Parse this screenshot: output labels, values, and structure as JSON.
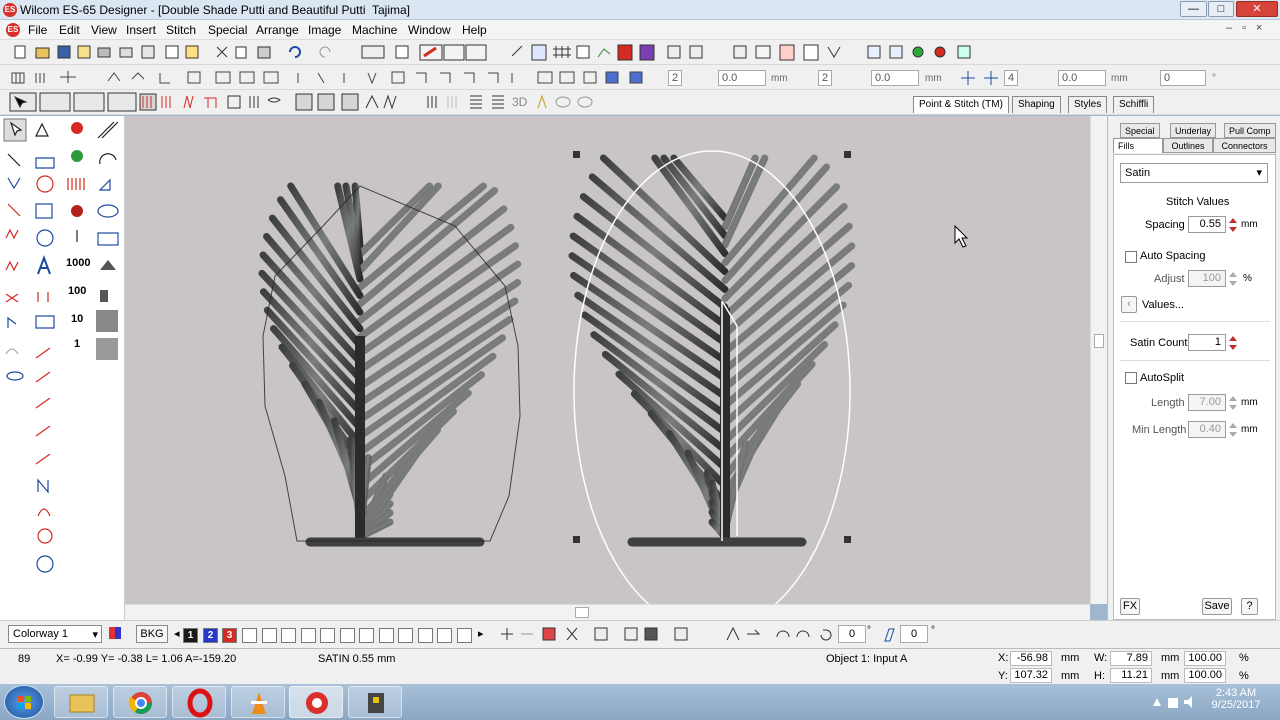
{
  "window": {
    "title": "Wilcom ES-65 Designer - [Double Shade Putti and Beautiful Putti",
    "machine": "Tajima]",
    "app_badge": "ES",
    "controls": [
      "—",
      "□",
      "✕"
    ],
    "inner_controls": [
      "–",
      "▫",
      "×"
    ]
  },
  "menu": [
    "File",
    "Edit",
    "View",
    "Insert",
    "Stitch",
    "Special",
    "Arrange",
    "Image",
    "Machine",
    "Window",
    "Help"
  ],
  "toolbar2": {
    "field1": "2",
    "value1": "0.0",
    "unit1": "mm",
    "field2": "2",
    "value2": "0.0",
    "unit2": "mm",
    "field3": "4",
    "value3": "0.0",
    "unit3": "mm",
    "value4": "0",
    "unit4": "°"
  },
  "toolbar3": {
    "label_3d": "3D"
  },
  "tabs": [
    "Point & Stitch (TM)",
    "Shaping",
    "Styles",
    "Schiffli"
  ],
  "left_tools": {
    "num1": "1000",
    "num2": "100",
    "num3": "10",
    "num4": "1"
  },
  "panel": {
    "tabs_row1": [
      "Special",
      "Underlay",
      "Pull Comp"
    ],
    "tabs_row2": [
      "Fills",
      "Outlines",
      "Connectors"
    ],
    "stitch_type": "Satin",
    "section_title": "Stitch Values",
    "spacing_label": "Spacing",
    "spacing_value": "0.55",
    "spacing_unit": "mm",
    "auto_spacing_label": "Auto Spacing",
    "adjust_label": "Adjust",
    "adjust_value": "100",
    "adjust_unit": "%",
    "values_button": "Values...",
    "satin_count_label": "Satin Count",
    "satin_count_value": "1",
    "autosplit_label": "AutoSplit",
    "length_label": "Length",
    "length_value": "7.00",
    "length_unit": "mm",
    "min_length_label": "Min Length",
    "min_length_value": "0.40",
    "min_length_unit": "mm",
    "fx_button": "FX",
    "save_button": "Save",
    "help_button": "?"
  },
  "colorbar": {
    "colorway": "Colorway 1",
    "bkg": "BKG",
    "swatches": [
      {
        "label": "1",
        "color": "#1a1a1a"
      },
      {
        "label": "2",
        "color": "#2638c9"
      },
      {
        "label": "3",
        "color": "#d42a22"
      }
    ],
    "angle1": "0",
    "angle1_unit": "°",
    "angle2": "0",
    "angle2_unit": "°"
  },
  "status": {
    "stitch_no": "89",
    "coords": "X= -0.99 Y= -0.38 L=   1.06 A=-159.20",
    "stitch_info": "SATIN  0.55 mm",
    "object": "Object 1: Input A",
    "x_label": "X:",
    "x_value": "-56.98",
    "x_unit": "mm",
    "y_label": "Y:",
    "y_value": "107.32",
    "y_unit": "mm",
    "w_label": "W:",
    "w_value": "7.89",
    "w_unit": "mm",
    "w_pct": "100.00",
    "w_pct_unit": "%",
    "h_label": "H:",
    "h_value": "11.21",
    "h_unit": "mm",
    "h_pct": "100.00",
    "h_pct_unit": "%"
  },
  "taskbar": {
    "time": "2:43 AM",
    "date": "9/25/2017",
    "apps": [
      "Windows Explorer",
      "Google Chrome",
      "Opera",
      "VLC media player",
      "Wilcom ES",
      "Tool"
    ]
  },
  "colors": {
    "canvas": "#c8c4c8",
    "stitch": "#55585a",
    "accent": "#d9302b"
  }
}
